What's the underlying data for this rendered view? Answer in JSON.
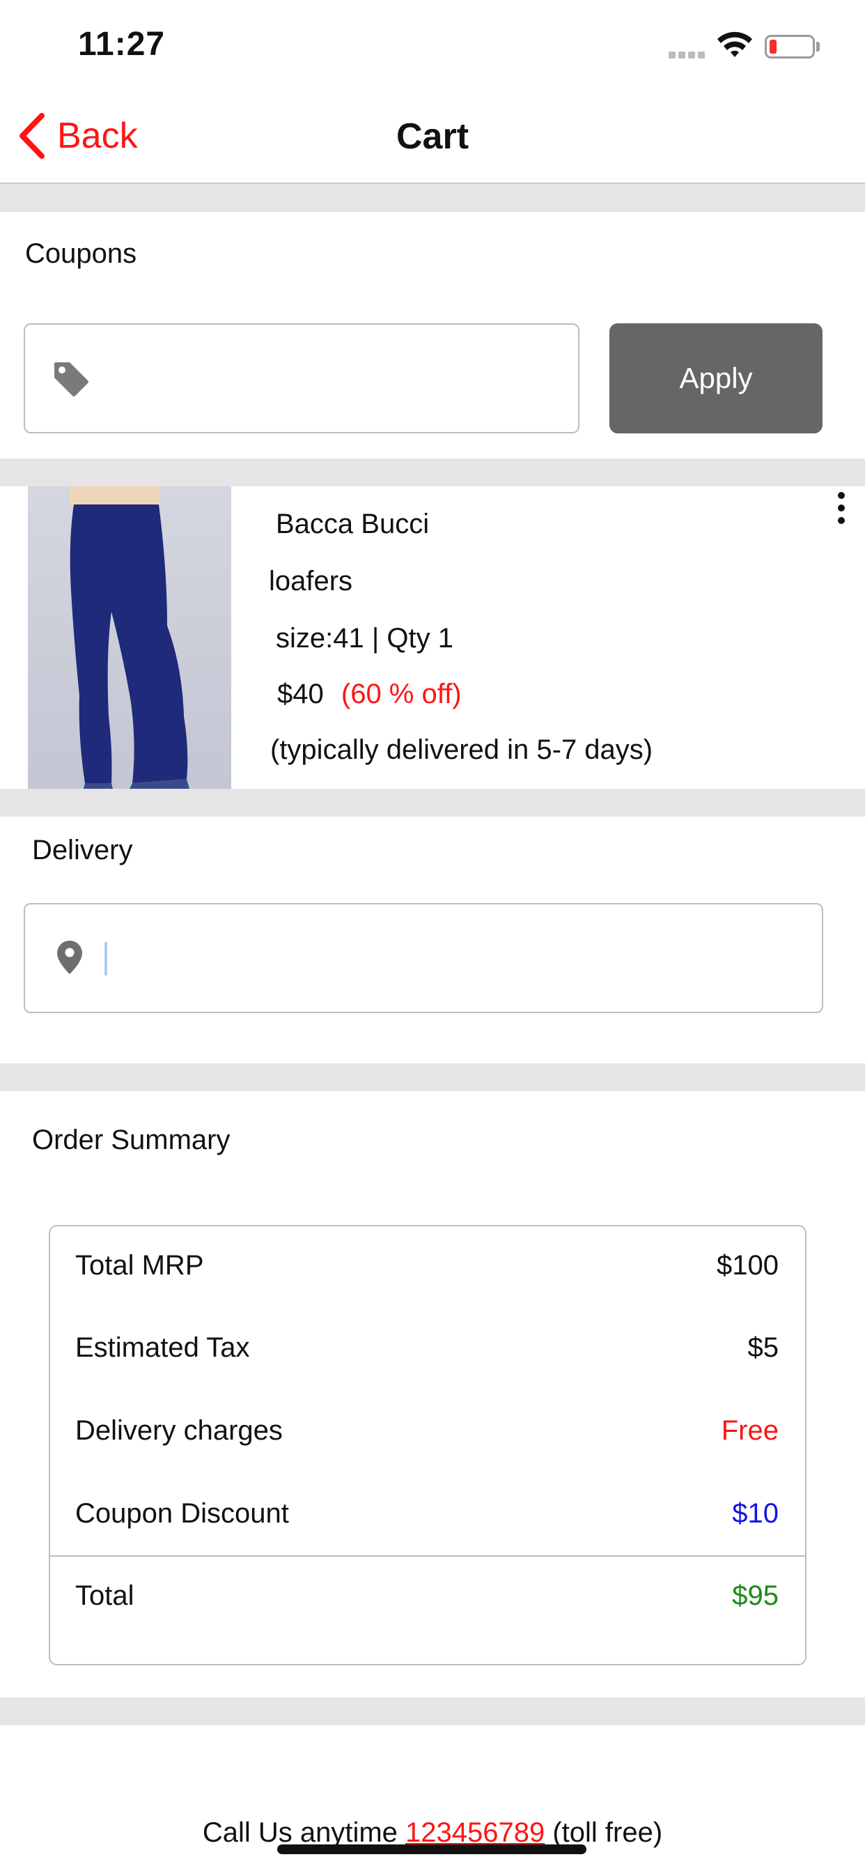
{
  "status_bar": {
    "time": "11:27"
  },
  "nav": {
    "back_label": "Back",
    "title": "Cart"
  },
  "coupons": {
    "label": "Coupons",
    "input_value": "",
    "apply_label": "Apply"
  },
  "product": {
    "brand": "Bacca Bucci",
    "name": "loafers",
    "size_qty": "size:41 | Qty 1",
    "price": "$40",
    "discount": "(60 % off)",
    "delivery_note": "(typically delivered in 5-7 days)"
  },
  "delivery": {
    "label": "Delivery",
    "input_value": ""
  },
  "order_summary": {
    "label": "Order Summary",
    "rows": [
      {
        "label": "Total MRP",
        "value": "$100",
        "color": "#111111"
      },
      {
        "label": "Estimated Tax",
        "value": "$5",
        "color": "#111111"
      },
      {
        "label": "Delivery charges",
        "value": "Free",
        "color": "#ff1414"
      },
      {
        "label": "Coupon Discount",
        "value": "$10",
        "color": "#1414e6"
      }
    ],
    "total": {
      "label": "Total",
      "value": "$95",
      "color": "#1a8a1a"
    }
  },
  "footer": {
    "prefix": "Call Us anytime ",
    "phone": "123456789",
    "suffix": " (toll free)"
  },
  "colors": {
    "accent": "#ff1414",
    "button": "#666666",
    "band": "#e5e5e5"
  }
}
